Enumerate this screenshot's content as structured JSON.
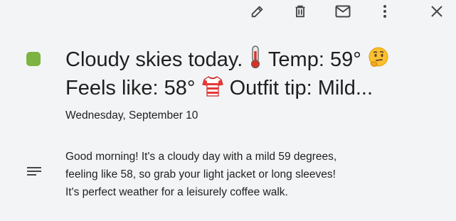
{
  "toolbar": {
    "icons": [
      "pencil-icon",
      "trash-icon",
      "mail-icon",
      "more-vert-icon",
      "close-icon"
    ]
  },
  "event": {
    "color": "#7cb342",
    "title_line1": "Cloudy skies today.",
    "title_temp": "Temp: 59°",
    "title_line2_a": "Feels like: 58°",
    "title_line2_b": "Outfit tip: Mild...",
    "date": "Wednesday, September 10",
    "description_lines": [
      "Good morning! It's a cloudy day with a mild 59 degrees,",
      "feeling like 58, so grab your light jacket or long sleeves!",
      "It's perfect weather for a leisurely coffee walk."
    ]
  }
}
